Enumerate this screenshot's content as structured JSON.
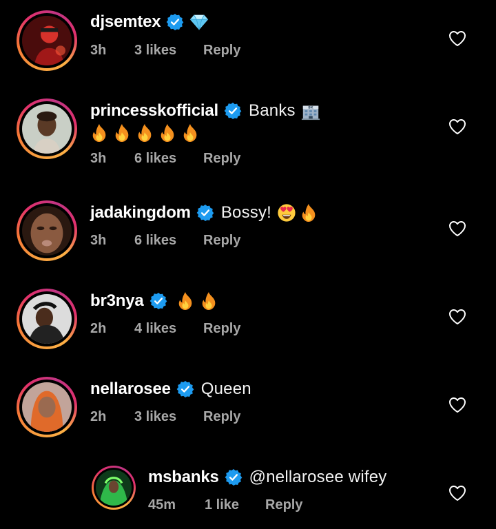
{
  "comments": [
    {
      "username": "djsemtex",
      "text": "",
      "emoji": "💎",
      "time": "3h",
      "likes": "3 likes",
      "reply": "Reply"
    },
    {
      "username": "princesskofficial",
      "text": "Banks",
      "emoji": "🏦🔥🔥🔥🔥🔥",
      "time": "3h",
      "likes": "6 likes",
      "reply": "Reply"
    },
    {
      "username": "jadakingdom",
      "text": "Bossy!",
      "emoji": "😍🔥",
      "time": "3h",
      "likes": "6 likes",
      "reply": "Reply"
    },
    {
      "username": "br3nya",
      "text": "",
      "emoji": "🔥🔥",
      "time": "2h",
      "likes": "4 likes",
      "reply": "Reply"
    },
    {
      "username": "nellarosee",
      "text": "Queen",
      "emoji": "",
      "time": "2h",
      "likes": "3 likes",
      "reply": "Reply"
    },
    {
      "username": "msbanks",
      "text": "@nellarosee wifey",
      "emoji": "",
      "time": "45m",
      "likes": "1 like",
      "reply": "Reply"
    }
  ],
  "icons": {
    "verified": "verified-badge-icon",
    "like": "heart-outline-icon",
    "fire": "fire-emoji-icon",
    "diamond": "gem-emoji-icon",
    "bank": "bank-building-emoji-icon",
    "heart_eyes": "heart-eyes-emoji-icon"
  },
  "colors": {
    "background": "#000000",
    "username": "#ffffff",
    "meta": "#a8a8a8",
    "verified": "#1d9bf0"
  }
}
